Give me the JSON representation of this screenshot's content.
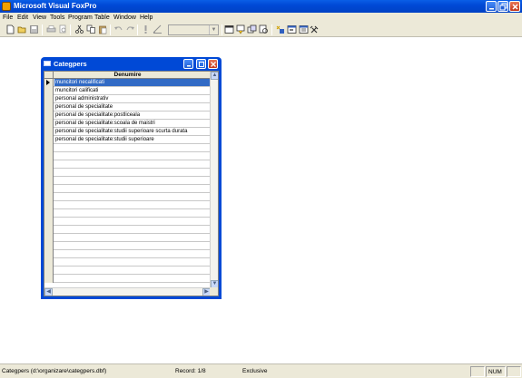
{
  "window": {
    "title": "Microsoft Visual FoxPro"
  },
  "menu": [
    "File",
    "Edit",
    "View",
    "Tools",
    "Program",
    "Table",
    "Window",
    "Help"
  ],
  "toolbar": {
    "icons": [
      "new-icon",
      "open-icon",
      "save-icon",
      "print-icon",
      "print-preview-icon",
      "cut-icon",
      "copy-icon",
      "paste-icon",
      "undo-icon",
      "redo-icon",
      "run-icon",
      "modify-form-icon",
      "database-icon",
      "command-window-icon",
      "view-window-icon",
      "data-session-icon",
      "properties-icon",
      "form-wizard-icon",
      "report-icon",
      "builder-icon"
    ],
    "combo_value": ""
  },
  "child_window": {
    "title": "Categpers",
    "column_header": "Denumire",
    "current_row": 0,
    "rows": [
      "muncitori necalificati",
      "muncitori calificati",
      "personal administrativ",
      "personal de specialitate",
      "personal de specialitate:postliceala",
      "personal de specialitate:scoala de maistri",
      "personal de specialitate:studii superioare scurta durata",
      "personal de specialitate:studii superioare"
    ],
    "empty_rows": 17
  },
  "status": {
    "alias": "Categpers (d:\\organizare\\categpers.dbf)",
    "record": "Record: 1/8",
    "mode": "Exclusive",
    "num": "NUM"
  }
}
